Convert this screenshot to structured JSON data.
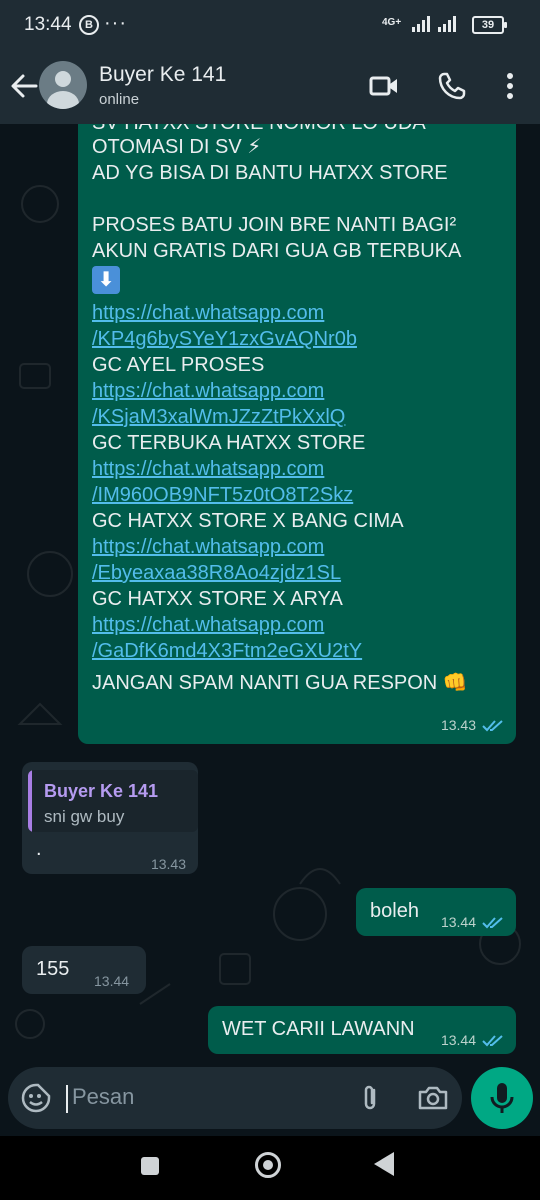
{
  "status_bar": {
    "time": "13:44",
    "b_badge": "B",
    "more": "···",
    "network": "4G+",
    "battery": "39"
  },
  "header": {
    "name": "Buyer Ke 141",
    "status": "online"
  },
  "messages": {
    "big": {
      "cut_line": "SV HATXX STORE NOMOR LO UDA",
      "lines": [
        "OTOMASI DI SV ⚡",
        "AD YG BISA DI BANTU HATXX STORE",
        "",
        "PROSES BATU JOIN BRE NANTI BAGI²",
        "AKUN GRATIS DARI GUA GB TERBUKA"
      ],
      "groups": [
        {
          "link1": "https://chat.whatsapp.com",
          "link2": "/KP4g6bySYeY1zxGvAQNr0b",
          "label": "GC AYEL PROSES"
        },
        {
          "link1": "https://chat.whatsapp.com",
          "link2": "/KSjaM3xalWmJZzZtPkXxlQ",
          "label": "GC TERBUKA HATXX STORE"
        },
        {
          "link1": "https://chat.whatsapp.com",
          "link2": "/IM960OB9NFT5z0tO8T2Skz",
          "label": "GC HATXX STORE X BANG CIMA"
        },
        {
          "link1": "https://chat.whatsapp.com",
          "link2": "/Ebyeaxaa38R8Ao4zjdz1SL",
          "label": "GC HATXX STORE X ARYA"
        },
        {
          "link1": "https://chat.whatsapp.com",
          "link2": "/GaDfK6md4X3Ftm2eGXU2tY",
          "label": "JANGAN SPAM NANTI GUA RESPON 👊"
        }
      ],
      "time": "13.43"
    },
    "reply": {
      "quote_name": "Buyer Ke 141",
      "quote_text": "sni gw buy",
      "text": ".",
      "time": "13.43"
    },
    "boleh": {
      "text": "boleh",
      "time": "13.44"
    },
    "num": {
      "text": "155",
      "time": "13.44"
    },
    "wet": {
      "text": "WET CARII LAWANN",
      "time": "13.44"
    }
  },
  "input": {
    "placeholder": "Pesan"
  },
  "colors": {
    "outgoing": "#005c4b",
    "incoming": "#1f2c34",
    "link": "#53bdeb",
    "accent": "#00a884"
  }
}
